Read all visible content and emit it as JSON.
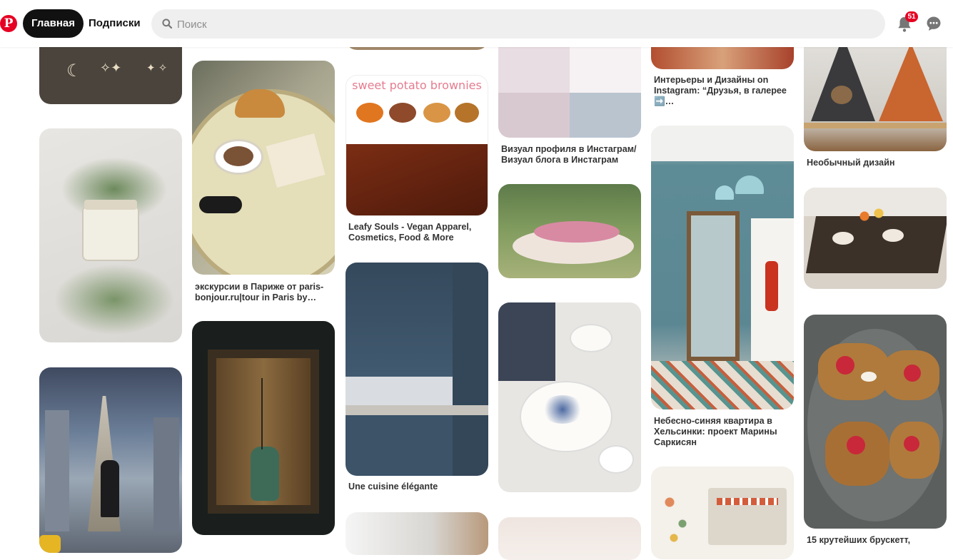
{
  "header": {
    "logo": "P",
    "nav_home": "Главная",
    "nav_following": "Подписки",
    "search_placeholder": "Поиск",
    "notification_count": "51"
  },
  "pins": [
    {
      "title": ""
    },
    {
      "title": ""
    },
    {
      "title": ""
    },
    {
      "title": ""
    },
    {
      "title": "экскурсии в Париже от paris-bonjour.ru|tour in Paris by…"
    },
    {
      "title": ""
    },
    {
      "title": ""
    },
    {
      "title": "Leafy Souls - Vegan Apparel, Cosmetics, Food & More"
    },
    {
      "title": "Une cuisine élégante"
    },
    {
      "title": ""
    },
    {
      "title": "Визуал профиля в Инстаграм/ Визуал блога в Инстаграм"
    },
    {
      "title": ""
    },
    {
      "title": ""
    },
    {
      "title": ""
    },
    {
      "title": "Интерьеры и Дизайны on Instagram: “Друзья, в галерее ➡️…"
    },
    {
      "title": "Небесно-синяя квартира в Хельсинки: проект Марины Саркисян"
    },
    {
      "title": ""
    },
    {
      "title": "Необычный дизайн"
    },
    {
      "title": ""
    },
    {
      "title": "15 крутейших брускетт,"
    }
  ],
  "image_text": {
    "brownies_heading": "sweet potato brownies"
  },
  "colors": {
    "brand": "#e60023",
    "nav_active_bg": "#111111",
    "search_bg": "#efefef"
  }
}
